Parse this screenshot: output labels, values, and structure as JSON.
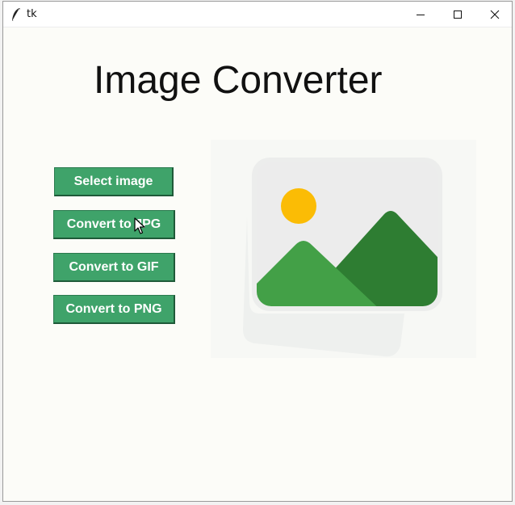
{
  "window": {
    "title": "tk",
    "icons": {
      "app": "feather-icon",
      "minimize": "minimize-icon",
      "maximize": "maximize-icon",
      "close": "close-icon"
    }
  },
  "main": {
    "heading": "Image Converter",
    "buttons": {
      "select": "Select image",
      "jpg": "Convert to JPG",
      "gif": "Convert to GIF",
      "png": "Convert to PNG"
    },
    "preview_icon": "image-placeholder-icon"
  },
  "colors": {
    "button_bg": "#3fa36a",
    "button_text": "#ffffff",
    "background": "#fcfcf8",
    "sun": "#fbbc05",
    "mountain_dark": "#2e7d32",
    "mountain_light": "#43a047"
  }
}
